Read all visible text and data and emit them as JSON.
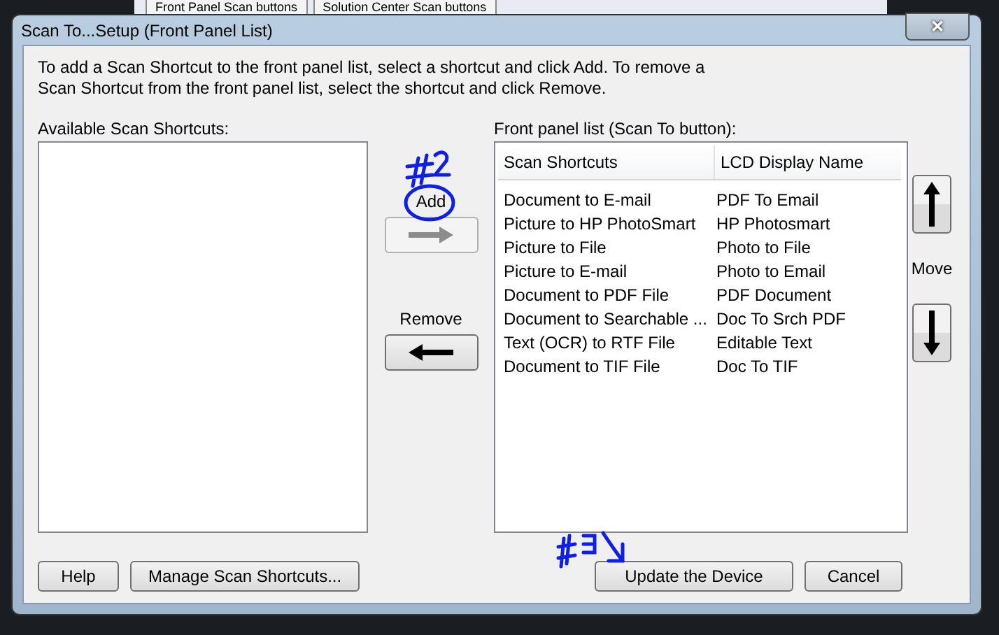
{
  "background_window": {
    "tabs": [
      "Front Panel Scan buttons",
      "Solution Center Scan buttons"
    ]
  },
  "window": {
    "title": "Scan To...Setup (Front Panel List)",
    "close": "✕"
  },
  "instructions": "To add a Scan Shortcut to the front panel list, select a shortcut and click Add. To remove a Scan Shortcut from the front panel list, select the shortcut and click Remove.",
  "available": {
    "label": "Available Scan Shortcuts:"
  },
  "transfer": [
    {
      "label": "Add",
      "kind": "right",
      "disabled": true
    },
    {
      "label": "Remove",
      "kind": "left",
      "disabled": false
    }
  ],
  "front_panel": {
    "label": "Front panel list (Scan To button):",
    "columns": [
      "Scan Shortcuts",
      "LCD Display Name"
    ],
    "rows": [
      [
        "Document to E-mail",
        "PDF To Email"
      ],
      [
        "Picture to HP PhotoSmart",
        "HP Photosmart"
      ],
      [
        "Picture to File",
        "Photo to File"
      ],
      [
        "Picture to E-mail",
        "Photo to Email"
      ],
      [
        "Document to PDF File",
        "PDF Document"
      ],
      [
        "Document to Searchable ...",
        "Doc To Srch PDF"
      ],
      [
        "Text (OCR) to RTF File",
        "Editable Text"
      ],
      [
        "Document to TIF File",
        "Doc To TIF"
      ]
    ]
  },
  "move": {
    "label": "Move"
  },
  "buttons_left": [
    "Help",
    "Manage Scan Shortcuts..."
  ],
  "buttons_right": [
    "Update the Device",
    "Cancel"
  ]
}
